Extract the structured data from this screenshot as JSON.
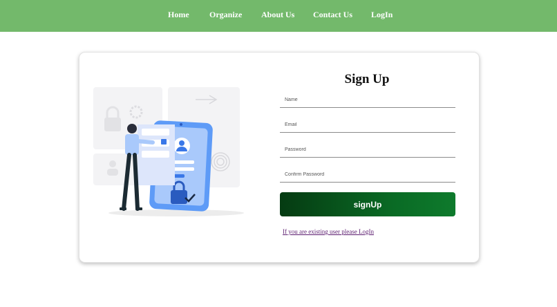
{
  "nav": {
    "items": [
      "Home",
      "Organize",
      "About Us",
      "Contact Us",
      "LogIn"
    ]
  },
  "form": {
    "title": "Sign Up",
    "name_placeholder": "Name",
    "email_placeholder": "Email",
    "password_placeholder": "Password",
    "confirm_password_placeholder": "Confirm Password",
    "signup_label": "signUp",
    "login_link": "If you are existing user please LogIn"
  },
  "colors": {
    "navbar": "#73b96b",
    "button_start": "#053b12",
    "button_end": "#0e7a2c",
    "illustration_accent": "#4a8df5"
  },
  "icons": [
    "user-icon",
    "lock-icon",
    "checkmark-icon"
  ]
}
